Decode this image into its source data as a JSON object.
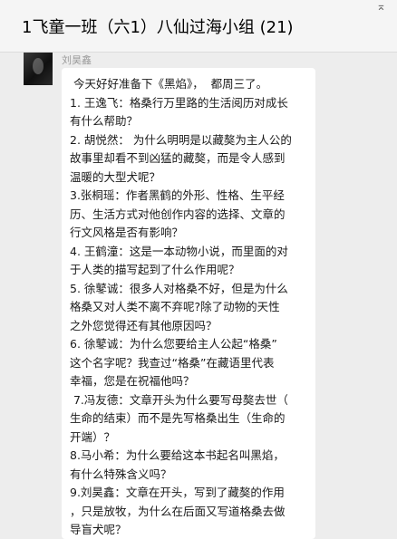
{
  "header": {
    "title": "1飞童一班（六1）八仙过海小组 (21)",
    "pin_icon": "pin-icon"
  },
  "message": {
    "sender": "刘昊鑫",
    "avatar_icon": "avatar",
    "lines": [
      " 今天好好准备下《黑焰》，  都周三了。",
      "1. 王逸飞：格桑行万里路的生活阅历对成长",
      "有什么帮助？",
      "2. 胡悦然： 为什么明明是以藏獒为主人公的",
      "故事里却看不到凶猛的藏獒，而是令人感到",
      "温暖的大型犬呢？",
      "3.张桐瑶：作者黑鹤的外形、性格、生平经",
      "历、生活方式对他创作内容的选择、文章的",
      "行文风格是否有影响？",
      "4. 王鹤潼：这是一本动物小说，而里面的对",
      "于人类的描写起到了什么作用呢？",
      "5. 徐鼕诚：很多人对格桑不好，但是为什么",
      "格桑又对人类不离不弃呢?除了动物的天性",
      "之外您觉得还有其他原因吗？",
      "6. 徐鼕诚：为什么您要给主人公起“格桑”",
      "这个名字呢？我查过“格桑”在藏语里代表",
      "幸福，您是在祝福他吗？",
      " 7.冯友德：文章开头为什么要写母獒去世（",
      "生命的结束）而不是先写格桑出生（生命的",
      "开端）？",
      "8.马小希：为什么要给这本书起名叫黑焰，",
      "有什么特殊含义吗？",
      "9.刘昊鑫：文章在开头，写到了藏獒的作用",
      "，只是放牧，为什么在后面又写道格桑去做",
      "导盲犬呢？"
    ]
  }
}
